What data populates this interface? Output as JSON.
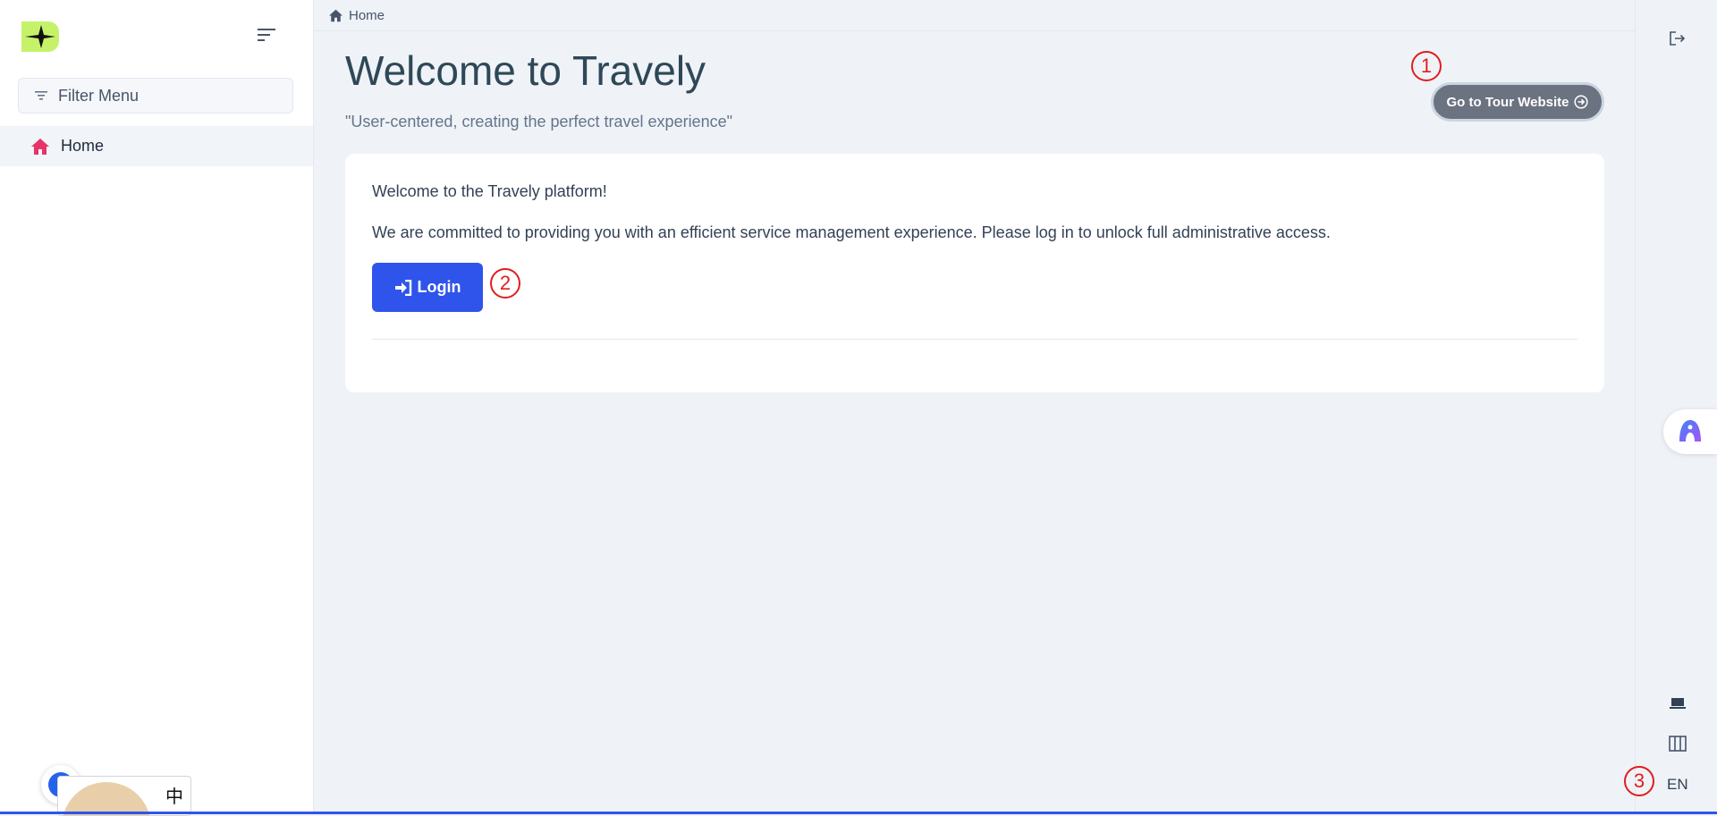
{
  "sidebar": {
    "filter_placeholder": "Filter Menu",
    "items": [
      {
        "label": "Home",
        "icon": "home-icon",
        "active": true
      }
    ]
  },
  "breadcrumb": {
    "items": [
      {
        "label": "Home",
        "icon": "home-icon"
      }
    ]
  },
  "main": {
    "title": "Welcome to Travely",
    "subtitle": "\"User-centered, creating the perfect travel experience\"",
    "tour_button": "Go to Tour Website",
    "card": {
      "greeting": "Welcome to the Travely platform!",
      "message": "We are committed to providing you with an efficient service management experience. Please log in to unlock full administrative access.",
      "login_label": "Login"
    }
  },
  "markers": {
    "one": "1",
    "two": "2",
    "three": "3"
  },
  "right_rail": {
    "language": "EN",
    "icons": [
      "logout-icon",
      "assistant-icon",
      "laptop-icon",
      "columns-icon"
    ]
  },
  "widgets": {
    "ime_label": "中"
  },
  "colors": {
    "primary": "#2f54eb",
    "accent_home": "#e6336b",
    "tour_button_bg": "#6b7280",
    "annotation": "#e11d1d"
  }
}
